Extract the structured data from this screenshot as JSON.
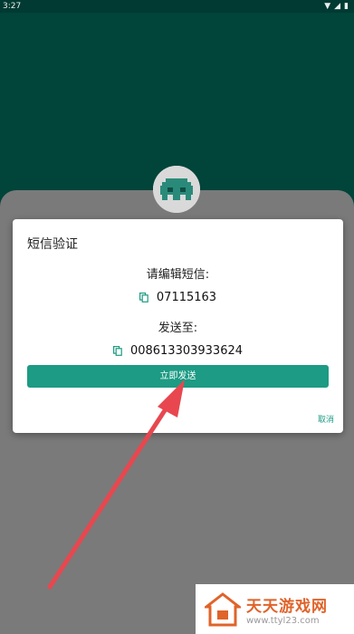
{
  "status_bar": {
    "time": "3:27",
    "wifi_icon": "wifi-icon",
    "signal_icon": "signal-icon",
    "battery_icon": "battery-icon"
  },
  "dialog": {
    "title": "短信验证",
    "edit_label": "请编辑短信:",
    "sms_content": "07115163",
    "send_to_label": "发送至:",
    "phone_number": "008613303933624",
    "send_button": "立即发送",
    "cancel": "取消",
    "copy_icon": "copy-icon"
  },
  "colors": {
    "accent": "#1d9b84",
    "header": "#00443a",
    "arrow": "#e8474f"
  },
  "watermark": {
    "title": "天天游戏网",
    "url": "www.ttyl23.com"
  }
}
